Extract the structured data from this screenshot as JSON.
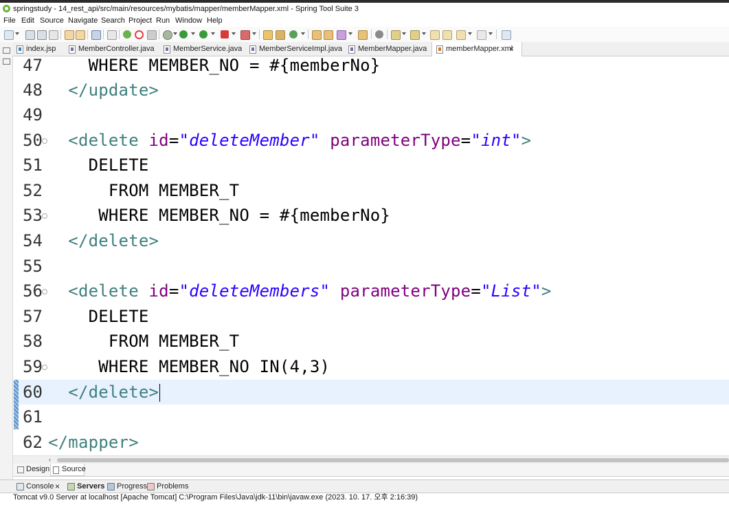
{
  "window": {
    "title": "springstudy - 14_rest_api/src/main/resources/mybatis/mapper/memberMapper.xml - Spring Tool Suite 3"
  },
  "menu": [
    "File",
    "Edit",
    "Source",
    "Navigate",
    "Search",
    "Project",
    "Run",
    "Window",
    "Help"
  ],
  "tabs": [
    {
      "label": "index.jsp",
      "type": "jsp"
    },
    {
      "label": "MemberController.java",
      "type": "java"
    },
    {
      "label": "MemberService.java",
      "type": "java"
    },
    {
      "label": "MemberServiceImpl.java",
      "type": "java"
    },
    {
      "label": "MemberMapper.java",
      "type": "java"
    },
    {
      "label": "memberMapper.xml",
      "type": "xml",
      "active": true,
      "close": "×"
    }
  ],
  "editor": {
    "lines": [
      {
        "num": "47",
        "fold": false,
        "text": "    WHERE MEMBER_NO = #{memberNo}"
      },
      {
        "num": "48",
        "fold": false,
        "text": "  </update>"
      },
      {
        "num": "49",
        "fold": false,
        "text": ""
      },
      {
        "num": "50",
        "fold": true,
        "text": "  <delete id=\"deleteMember\" parameterType=\"int\">"
      },
      {
        "num": "51",
        "fold": false,
        "text": "    DELETE"
      },
      {
        "num": "52",
        "fold": false,
        "text": "      FROM MEMBER_T"
      },
      {
        "num": "53",
        "fold": true,
        "text": "     WHERE MEMBER_NO = #{memberNo}"
      },
      {
        "num": "54",
        "fold": false,
        "text": "  </delete>"
      },
      {
        "num": "55",
        "fold": false,
        "text": ""
      },
      {
        "num": "56",
        "fold": true,
        "text": "  <delete id=\"deleteMembers\" parameterType=\"List\">"
      },
      {
        "num": "57",
        "fold": false,
        "text": "    DELETE"
      },
      {
        "num": "58",
        "fold": false,
        "text": "      FROM MEMBER_T"
      },
      {
        "num": "59",
        "fold": true,
        "text": "     WHERE MEMBER_NO IN(4,3)"
      },
      {
        "num": "60",
        "fold": false,
        "text": "  </delete>"
      },
      {
        "num": "61",
        "fold": false,
        "text": ""
      },
      {
        "num": "62",
        "fold": false,
        "text": "</mapper>"
      }
    ],
    "current_line": "60"
  },
  "editor_mode_tabs": [
    {
      "label": "Design"
    },
    {
      "label": "Source",
      "active": true
    }
  ],
  "bottom_tabs": [
    {
      "label": "Console",
      "close": "×"
    },
    {
      "label": "Servers",
      "bold": true
    },
    {
      "label": "Progress"
    },
    {
      "label": "Problems"
    }
  ],
  "console_status": "Tomcat v9.0 Server at localhost [Apache Tomcat] C:\\Program Files\\Java\\jdk-11\\bin\\javaw.exe  (2023. 10. 17. 오후 2:16:39)",
  "colors": {
    "tag": "#3f7f7f",
    "attribute": "#7f007f",
    "string": "#2a00ff",
    "current_line": "#e8f2fe"
  }
}
